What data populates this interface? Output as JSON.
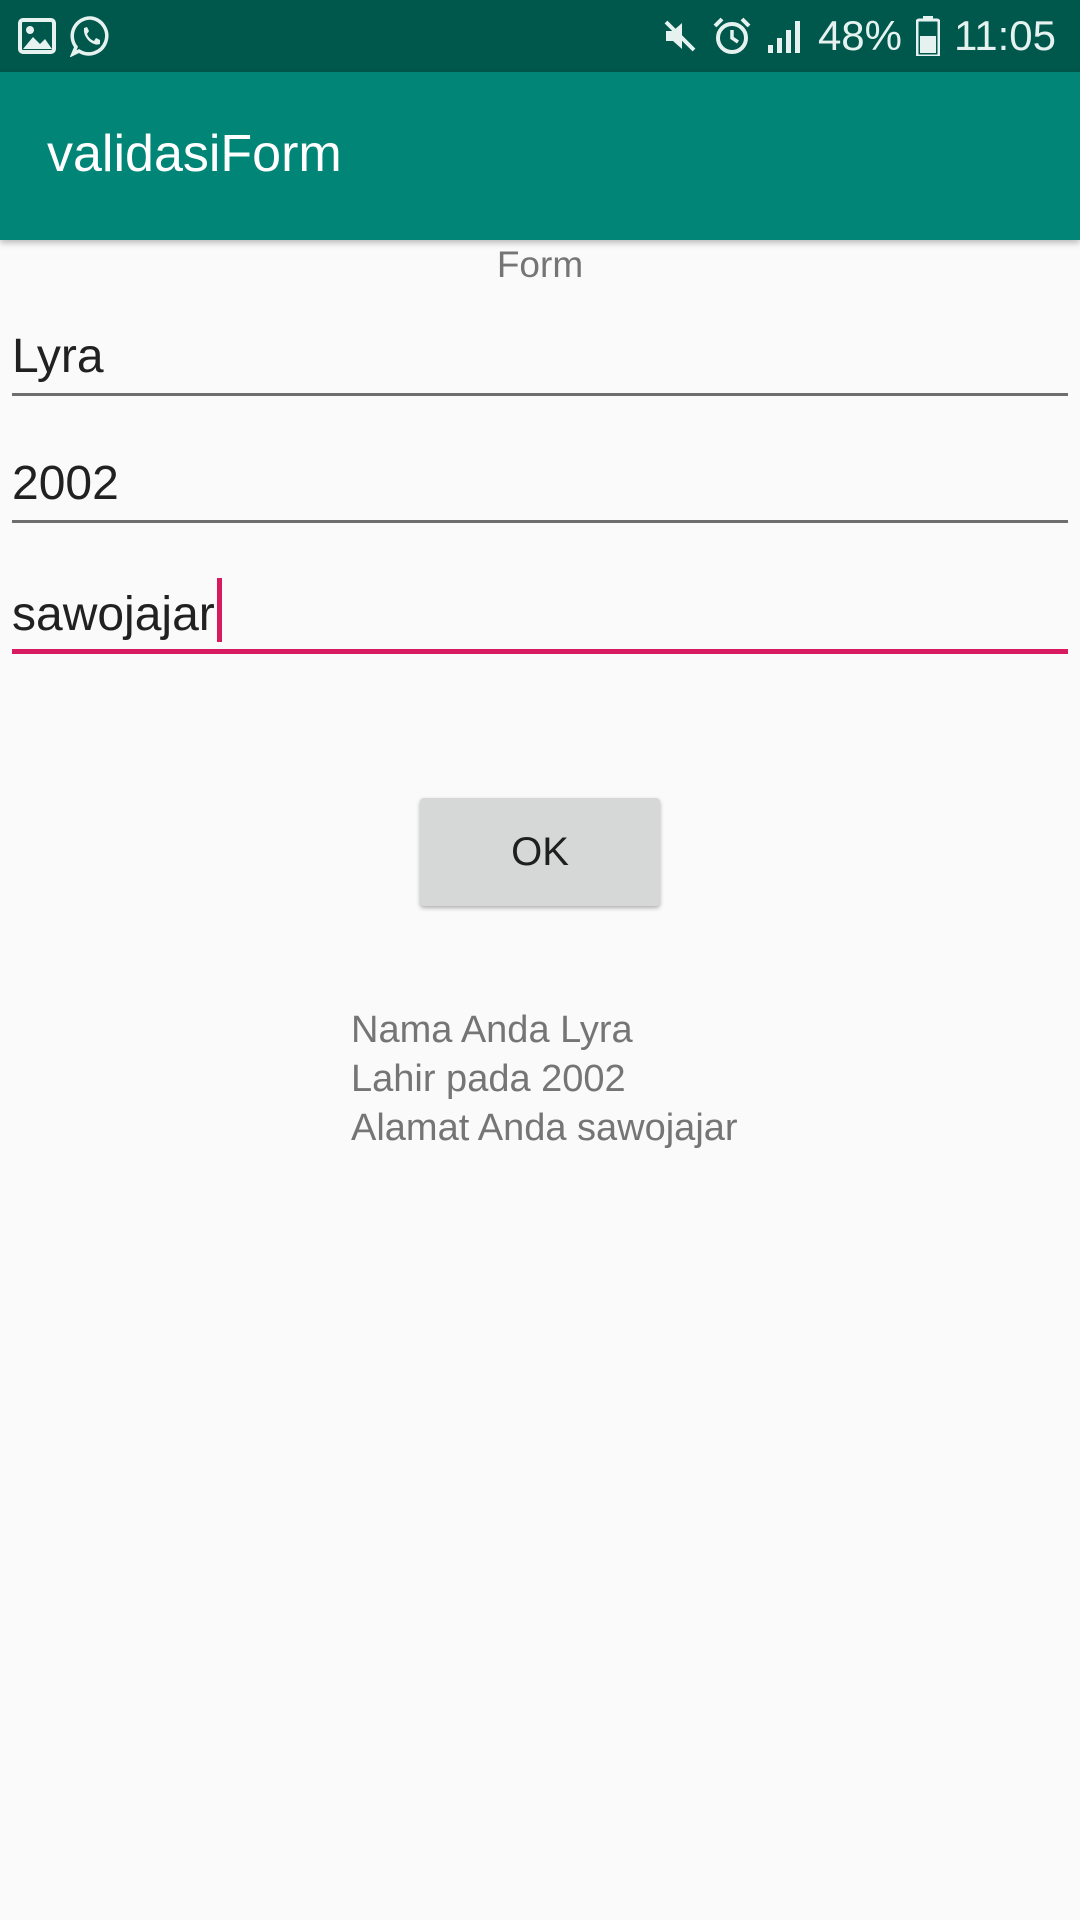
{
  "status_bar": {
    "battery": "48%",
    "time": "11:05",
    "icons": [
      "gallery-icon",
      "whatsapp-icon",
      "mute-icon",
      "alarm-icon",
      "signal-icon",
      "battery-icon"
    ]
  },
  "app_bar": {
    "title": "validasiForm",
    "color": "#008577"
  },
  "form": {
    "label": "Form",
    "name_value": "Lyra",
    "year_value": "2002",
    "address_value": "sawojajar",
    "focused_field": "address",
    "accent_color": "#d81b60"
  },
  "ok_button": {
    "label": "OK"
  },
  "result": {
    "line1": "Nama Anda Lyra",
    "line2": "Lahir pada 2002",
    "line3": "Alamat Anda sawojajar"
  }
}
